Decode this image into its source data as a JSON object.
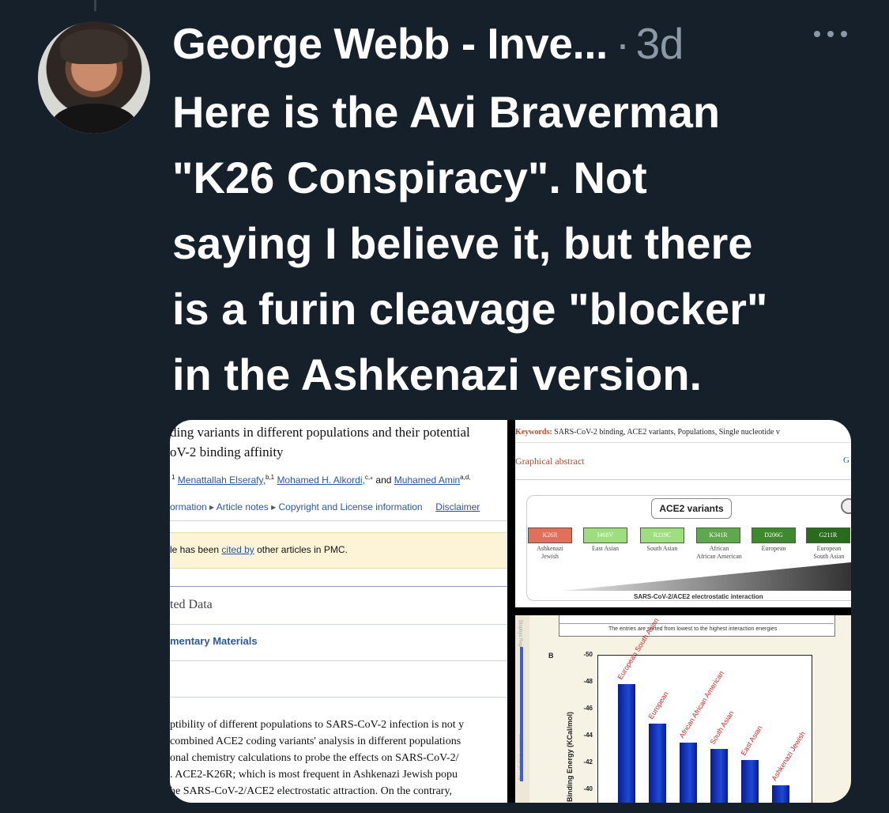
{
  "tweet": {
    "author": "George Webb - Inve...",
    "separator": "·",
    "time": "3d",
    "text": "Here is the Avi Braverman\n\"K26 Conspiracy\".  Not\nsaying I believe it, but there\nis a furin cleavage \"blocker\"\nin the Ashkenazi version."
  },
  "left_image": {
    "title_line1": "ding variants in different populations and their potential",
    "title_line2": "oV-2 binding affinity",
    "authors": {
      "a1_sup": "1",
      "a2": "Menattallah Elserafy,",
      "a2_sup": "b,1",
      "a3": "Mohamed H. Alkordi,",
      "a3_sup": "c,⁎",
      "and": "and",
      "a4": "Muhamed Amin",
      "a4_sup": "a,d,"
    },
    "nav": {
      "item1": "ormation",
      "item2": "Article notes",
      "item3": "Copyright and License information",
      "item4": "Disclaimer"
    },
    "cited": {
      "prefix": "le has been",
      "link": "cited by",
      "suffix": "other articles in PMC."
    },
    "related_heading": "ted Data",
    "supp_heading": "mentary Materials",
    "abstract": [
      "ptibility of different populations to SARS-CoV-2 infection is not y",
      "combined ACE2 coding variants' analysis in different populations",
      "onal chemistry calculations to probe the effects on SARS-CoV-2/",
      ". ACE2-K26R; which is most frequent in Ashkenazi Jewish popu",
      "he SARS-CoV-2/ACE2 electrostatic attraction. On the contrary,"
    ]
  },
  "top_right_image": {
    "keywords_label": "Keywords:",
    "keywords": "SARS-CoV-2 binding, ACE2 variants, Populations, Single nucleotide v",
    "graphical_abstract": "Graphical abstract",
    "corner_letter": "G",
    "box_title": "ACE2 variants",
    "variants": [
      {
        "code": "K26R",
        "pop1": "Ashkenazi",
        "pop2": "Jewish",
        "color": "#e0705a"
      },
      {
        "code": "I468V",
        "pop1": "East Asian",
        "pop2": "",
        "color": "#9ede7e"
      },
      {
        "code": "R219C",
        "pop1": "South Asian",
        "pop2": "",
        "color": "#9ede7e"
      },
      {
        "code": "K341R",
        "pop1": "African",
        "pop2": "African American",
        "color": "#5fa84b"
      },
      {
        "code": "D206G",
        "pop1": "European",
        "pop2": "",
        "color": "#3d8a2c"
      },
      {
        "code": "G211R",
        "pop1": "European",
        "pop2": "South Asian",
        "color": "#2a6a1c"
      }
    ],
    "axis_caption": "SARS-CoV-2/ACE2 electrostatic interaction"
  },
  "bottom_right_image": {
    "table_note": "The entries are sorted from lowest to the highest interaction energies",
    "panel_letter": "B",
    "side_text": "Biophys Rep",
    "side_text_2": "Biochem Biophys Rep",
    "colors": {
      "bar": "#1a3fcf",
      "label": "#cc2a2a"
    }
  },
  "chart_data": {
    "type": "bar",
    "ylabel": "Binding Energy (KCal/mol)",
    "ytick_labels": [
      "-50",
      "-48",
      "-46",
      "-44",
      "-42",
      "-40"
    ],
    "ylim": [
      -50,
      -39
    ],
    "categories": [
      "European South Asian",
      "European",
      "African African American",
      "South Asian",
      "East Asian",
      "Ashkenazi Jewish"
    ],
    "values": [
      -47.8,
      -44.9,
      -43.5,
      -43.0,
      -42.2,
      -40.3
    ]
  }
}
